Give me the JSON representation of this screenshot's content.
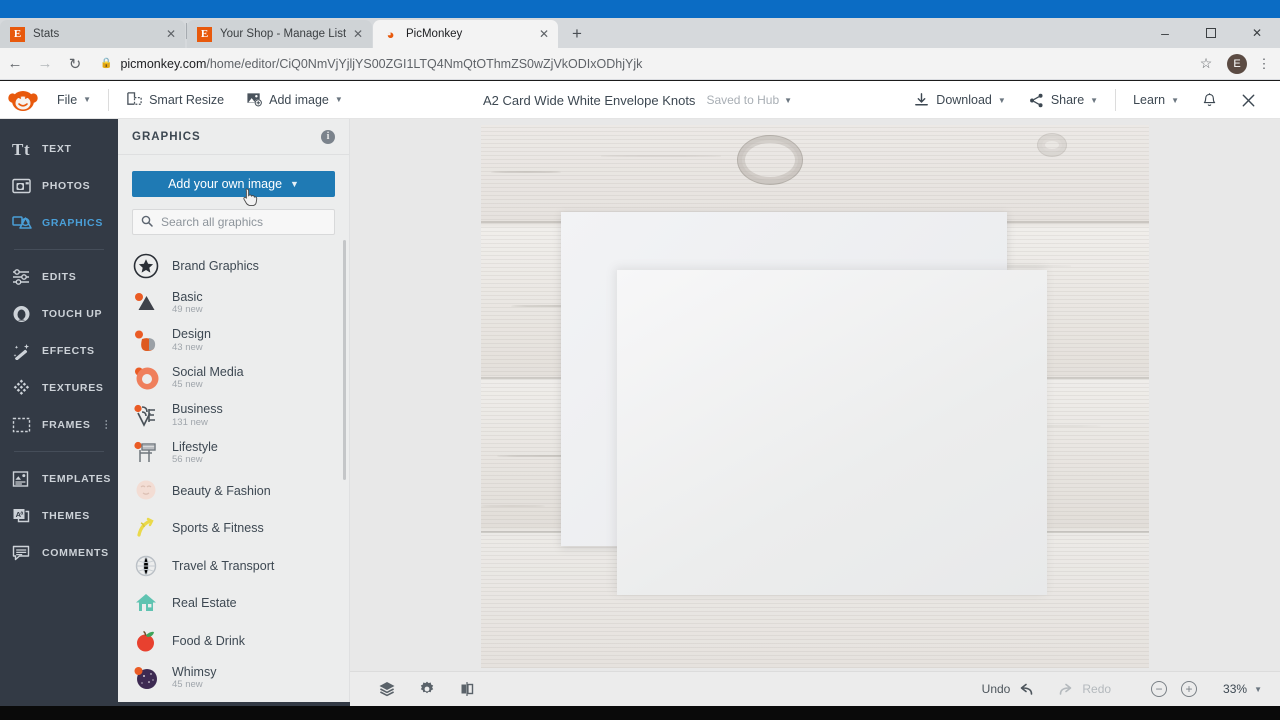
{
  "browser": {
    "tabs": [
      {
        "title": "Stats",
        "favicon": "etsy-icon",
        "active": false
      },
      {
        "title": "Your Shop - Manage Listings - Et",
        "favicon": "etsy-icon",
        "active": false
      },
      {
        "title": "PicMonkey",
        "favicon": "picmonkey-icon",
        "active": true
      }
    ],
    "new_tab_label": "+",
    "window_controls": {
      "minimize": "–",
      "maximize": "□",
      "close": "✕"
    },
    "nav": {
      "back": "←",
      "forward": "→",
      "reload": "↻"
    },
    "url_host": "picmonkey.com",
    "url_path": "/home/editor/CiQ0NmVjYjljYS00ZGI1LTQ4NmQtOThmZS0wZjVkODIxODhjYjk",
    "lock_icon": "lock-icon",
    "bookmark_icon": "star-icon",
    "profile_initial": "E",
    "menu_icon": "kebab-menu-icon"
  },
  "header": {
    "logo": "picmonkey-monkey-logo",
    "file_menu": "File",
    "smart_resize": "Smart Resize",
    "add_image": "Add image",
    "doc_title": "A2 Card Wide White Envelope Knots",
    "saved_status": "Saved to Hub",
    "download": "Download",
    "share": "Share",
    "learn": "Learn",
    "bell": "notification-bell-icon",
    "close": "close-editor-icon"
  },
  "left_rail": {
    "groups": [
      [
        {
          "label": "TEXT",
          "icon": "text-icon",
          "active": false
        },
        {
          "label": "PHOTOS",
          "icon": "photos-icon",
          "active": false
        },
        {
          "label": "GRAPHICS",
          "icon": "graphics-icon",
          "active": true
        }
      ],
      [
        {
          "label": "EDITS",
          "icon": "sliders-icon",
          "active": false
        },
        {
          "label": "TOUCH UP",
          "icon": "face-icon",
          "active": false
        },
        {
          "label": "EFFECTS",
          "icon": "magic-wand-icon",
          "active": false
        },
        {
          "label": "TEXTURES",
          "icon": "textures-icon",
          "active": false
        },
        {
          "label": "FRAMES",
          "icon": "frames-icon",
          "active": false,
          "overflow": true
        }
      ],
      [
        {
          "label": "TEMPLATES",
          "icon": "templates-icon",
          "active": false
        },
        {
          "label": "THEMES",
          "icon": "themes-icon",
          "active": false
        },
        {
          "label": "COMMENTS",
          "icon": "comments-icon",
          "active": false
        }
      ]
    ]
  },
  "panel": {
    "title": "GRAPHICS",
    "info_icon": "info-icon",
    "add_own_image": "Add your own image",
    "search_placeholder": "Search all graphics",
    "search_value": "",
    "categories": [
      {
        "name": "Brand Graphics",
        "sub": "",
        "icon": "star-badge-icon"
      },
      {
        "name": "Basic",
        "sub": "49 new",
        "icon": "basic-shapes-icon"
      },
      {
        "name": "Design",
        "sub": "43 new",
        "icon": "design-icon"
      },
      {
        "name": "Social Media",
        "sub": "45 new",
        "icon": "social-media-icon"
      },
      {
        "name": "Business",
        "sub": "131 new",
        "icon": "business-icon"
      },
      {
        "name": "Lifestyle",
        "sub": "56 new",
        "icon": "lifestyle-icon"
      },
      {
        "name": "Beauty & Fashion",
        "sub": "",
        "icon": "beauty-fashion-icon"
      },
      {
        "name": "Sports & Fitness",
        "sub": "",
        "icon": "sports-fitness-icon"
      },
      {
        "name": "Travel & Transport",
        "sub": "",
        "icon": "travel-transport-icon"
      },
      {
        "name": "Real Estate",
        "sub": "",
        "icon": "house-icon"
      },
      {
        "name": "Food & Drink",
        "sub": "",
        "icon": "food-drink-icon"
      },
      {
        "name": "Whimsy",
        "sub": "45 new",
        "icon": "whimsy-icon"
      }
    ]
  },
  "bottom_bar": {
    "layers_icon": "layers-icon",
    "settings_icon": "gear-icon",
    "flip_icon": "flip-icon",
    "undo": "Undo",
    "redo": "Redo",
    "zoom_out": "−",
    "zoom_in": "+",
    "zoom_level": "33%"
  },
  "colors": {
    "accent_blue": "#1f7ab4",
    "rail_bg": "#333a45",
    "active_item": "#4a9fd8",
    "brand_orange": "#e8590c"
  }
}
